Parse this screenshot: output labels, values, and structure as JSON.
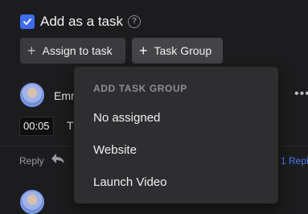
{
  "task_option": {
    "label": "Add as a task",
    "checked": true
  },
  "buttons": {
    "assign_label": "Assign to task",
    "group_label": "Task Group"
  },
  "comment": {
    "author": "Emm",
    "timestamp": "00:05",
    "text": "T",
    "reply_label": "Reply",
    "replies_link": "1 Repl"
  },
  "dropdown": {
    "header": "ADD TASK GROUP",
    "items": [
      "No assigned",
      "Website",
      "Launch Video"
    ]
  },
  "colors": {
    "accent": "#3d6cf0",
    "link": "#4a7cf5",
    "background": "#1c1c1e",
    "dropdown_bg": "#2e2e31"
  }
}
